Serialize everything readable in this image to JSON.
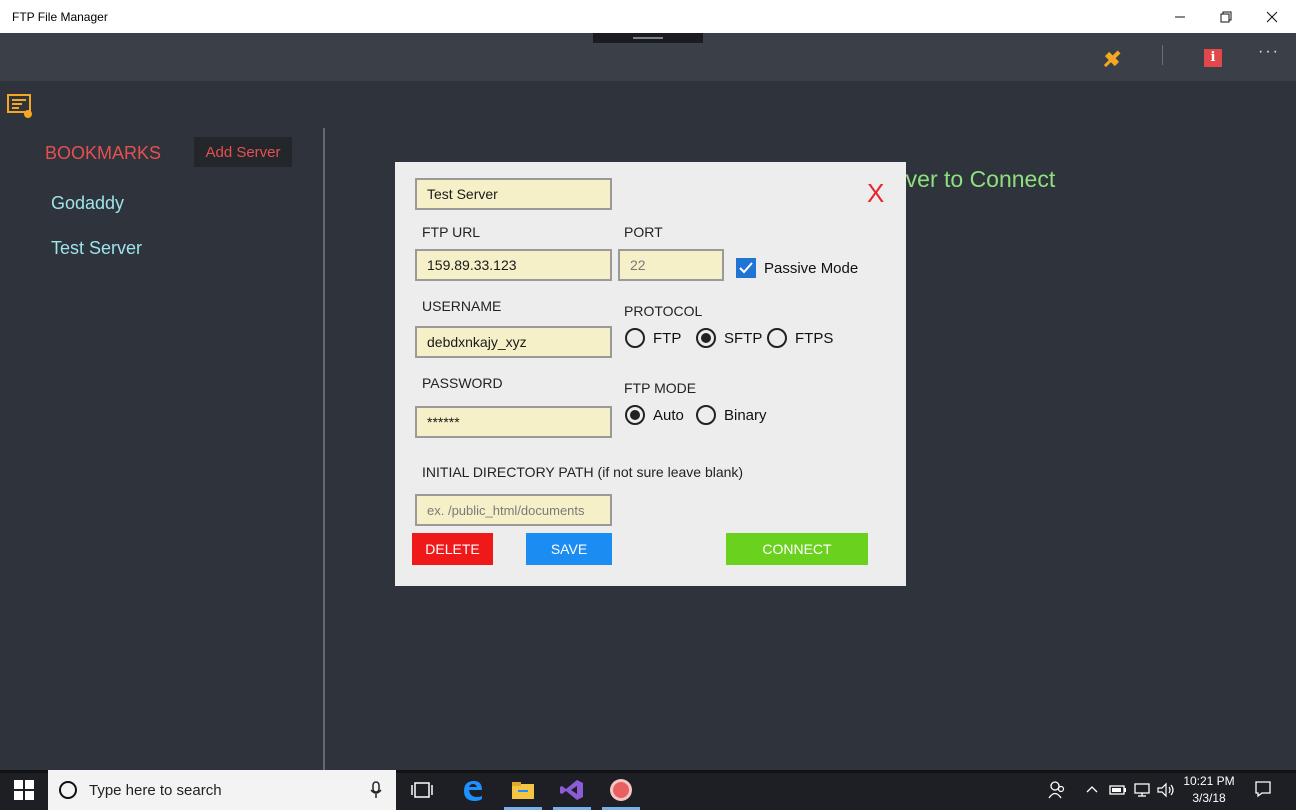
{
  "window": {
    "title": "FTP File Manager"
  },
  "sidebar": {
    "title": "BOOKMARKS",
    "add_button": "Add Server",
    "items": [
      {
        "label": "Godaddy"
      },
      {
        "label": "Test Server"
      }
    ]
  },
  "main": {
    "hint": "rver to Connect"
  },
  "dialog": {
    "server_name": "Test Server",
    "close_label": "X",
    "ftp_url_label": "FTP URL",
    "ftp_url_value": "159.89.33.123",
    "port_label": "PORT",
    "port_value": "22",
    "passive_mode_label": "Passive Mode",
    "passive_mode_checked": true,
    "username_label": "USERNAME",
    "username_value": "debdxnkajy_xyz",
    "protocol_label": "PROTOCOL",
    "protocols": [
      {
        "label": "FTP",
        "checked": false
      },
      {
        "label": "SFTP",
        "checked": true
      },
      {
        "label": "FTPS",
        "checked": false
      }
    ],
    "password_label": "PASSWORD",
    "password_value": "******",
    "ftp_mode_label": "FTP MODE",
    "ftp_modes": [
      {
        "label": "Auto",
        "checked": true
      },
      {
        "label": "Binary",
        "checked": false
      }
    ],
    "initial_dir_label": "INITIAL DIRECTORY PATH (if not sure leave blank)",
    "initial_dir_placeholder": "ex. /public_html/documents",
    "delete_label": "DELETE",
    "save_label": "SAVE",
    "connect_label": "CONNECT"
  },
  "taskbar": {
    "search_placeholder": "Type here to search",
    "time": "10:21 PM",
    "date": "3/3/18"
  },
  "colors": {
    "accent_red": "#e5514f",
    "link_cyan": "#9fe3ea",
    "hint_green": "#8ee07e",
    "delete_red": "#ef1919",
    "save_blue": "#1b8cf2",
    "connect_green": "#6bd11f",
    "field_bg": "#f5f0c8"
  }
}
